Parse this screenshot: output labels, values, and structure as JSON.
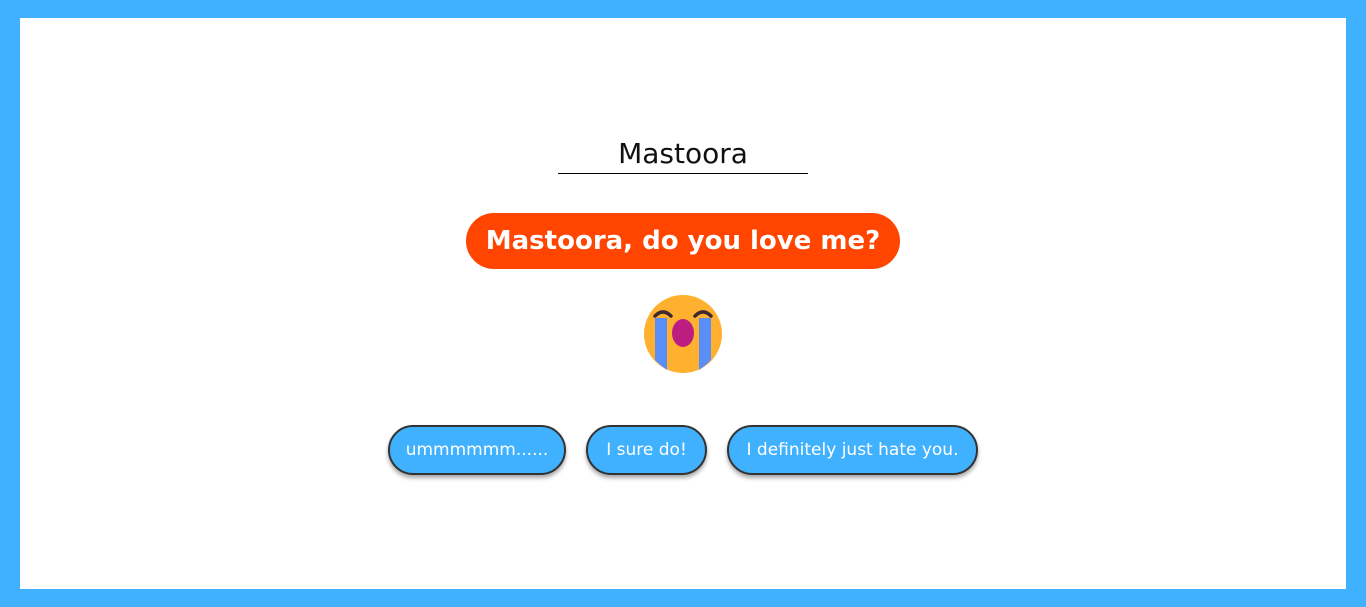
{
  "name_input": {
    "value": "Mastoora"
  },
  "question": {
    "text": "Mastoora, do you love me?"
  },
  "emoji": {
    "icon": "loudly-crying-face-icon"
  },
  "buttons": [
    {
      "label": "ummmmmm......"
    },
    {
      "label": "I sure do!"
    },
    {
      "label": "I definitely just hate you."
    }
  ],
  "colors": {
    "border": "#40b1ff",
    "question_bg": "#ff4500",
    "button_bg": "#40b1ff",
    "face": "#ffb02e",
    "tears": "#5a8ef7",
    "mouth": "#bb1d80",
    "eyebrows": "#402a32"
  }
}
